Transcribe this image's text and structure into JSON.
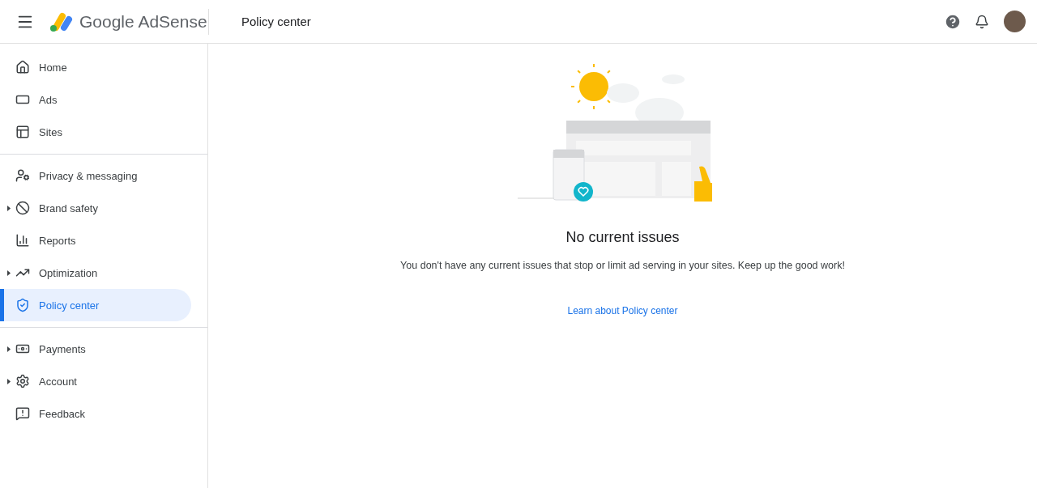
{
  "header": {
    "product": "Google AdSense",
    "page_title": "Policy center"
  },
  "sidebar": {
    "groups": [
      [
        {
          "label": "Home",
          "selected": false,
          "expandable": false
        },
        {
          "label": "Ads",
          "selected": false,
          "expandable": false
        },
        {
          "label": "Sites",
          "selected": false,
          "expandable": false
        }
      ],
      [
        {
          "label": "Privacy & messaging",
          "selected": false,
          "expandable": false
        },
        {
          "label": "Brand safety",
          "selected": false,
          "expandable": true
        },
        {
          "label": "Reports",
          "selected": false,
          "expandable": false
        },
        {
          "label": "Optimization",
          "selected": false,
          "expandable": true
        },
        {
          "label": "Policy center",
          "selected": true,
          "expandable": false
        }
      ],
      [
        {
          "label": "Payments",
          "selected": false,
          "expandable": true
        },
        {
          "label": "Account",
          "selected": false,
          "expandable": true
        },
        {
          "label": "Feedback",
          "selected": false,
          "expandable": false
        }
      ]
    ]
  },
  "main": {
    "title": "No current issues",
    "message": "You don't have any current issues that stop or limit ad serving in your sites. Keep up the good work!",
    "link": "Learn about Policy center"
  }
}
